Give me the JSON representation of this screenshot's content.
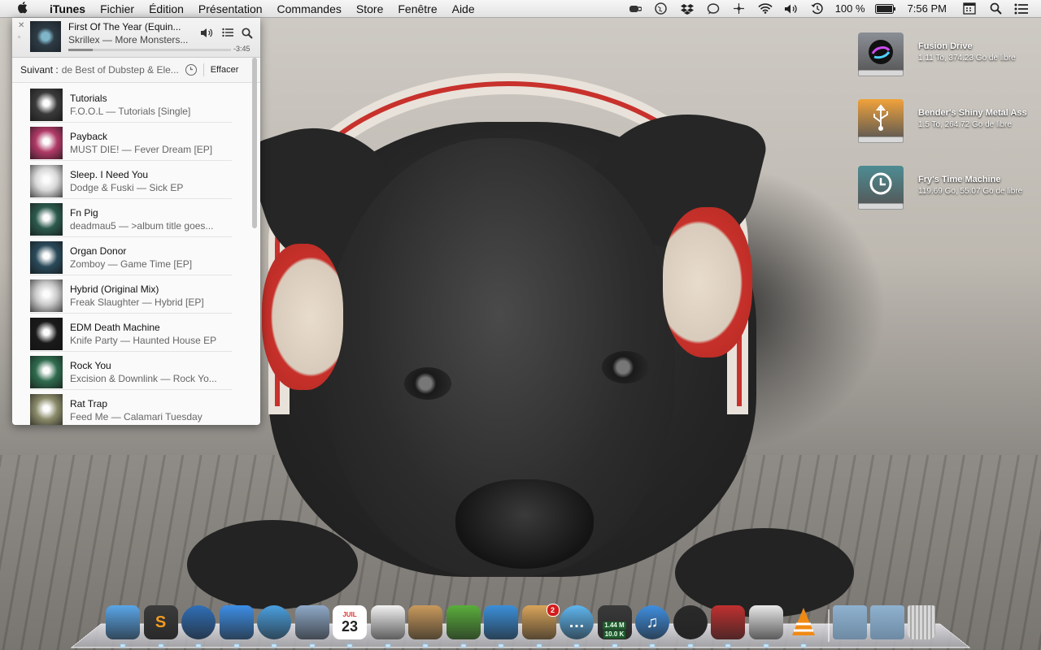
{
  "menubar": {
    "apple": "",
    "menus": [
      "iTunes",
      "Fichier",
      "Édition",
      "Présentation",
      "Commandes",
      "Store",
      "Fenêtre",
      "Aide"
    ],
    "battery": "100 %",
    "clock": "7:56 PM"
  },
  "player": {
    "now_playing": {
      "title": "First Of The Year (Equin...",
      "artist_album": "Skrillex — More Monsters...",
      "remaining": "-3:45",
      "progress": 0.15
    },
    "up_next": {
      "label": "Suivant :",
      "source": "de Best of Dubstep & Ele...",
      "clear": "Effacer"
    },
    "tracks": [
      {
        "title": "Tutorials",
        "sub": "F.O.O.L — Tutorials [Single]",
        "art": "#3a3a3a"
      },
      {
        "title": "Payback",
        "sub": "MUST DIE! — Fever Dream [EP]",
        "art": "#b03a66"
      },
      {
        "title": "Sleep. I Need You",
        "sub": "Dodge & Fuski — Sick EP",
        "art": "#d8d8d8"
      },
      {
        "title": "Fn Pig",
        "sub": "deadmau5 — >album title goes...",
        "art": "#2c5a4c"
      },
      {
        "title": "Organ Donor",
        "sub": "Zomboy — Game Time [EP]",
        "art": "#2a4a5a"
      },
      {
        "title": "Hybrid (Original Mix)",
        "sub": "Freak Slaughter — Hybrid [EP]",
        "art": "#c9c9c9"
      },
      {
        "title": "EDM Death Machine",
        "sub": "Knife Party — Haunted House EP",
        "art": "#1a1a1a"
      },
      {
        "title": "Rock You",
        "sub": "Excision & Downlink — Rock Yo...",
        "art": "#2f6b4e"
      },
      {
        "title": "Rat Trap",
        "sub": "Feed Me — Calamari Tuesday",
        "art": "#8a8a6a"
      }
    ]
  },
  "desktop": [
    {
      "name": "Fusion Drive",
      "info": "1.11 To, 374.23 Go de libre",
      "icon": "hard-drive-icon",
      "color": "#8b8f96"
    },
    {
      "name": "Bender's Shiny Metal Ass",
      "info": "1.5 To, 264.72 Go de libre",
      "icon": "usb-drive-icon",
      "color": "#f0a23a"
    },
    {
      "name": "Fry's Time Machine",
      "info": "119.69 Go, 55.07 Go de libre",
      "icon": "time-machine-drive-icon",
      "color": "#4d8c93"
    }
  ],
  "dock": {
    "calendar_day": "23",
    "calendar_month": "JUIL",
    "netstat_up": "1.44 M",
    "netstat_down": "10.0 K",
    "app_store_badge": "2",
    "apps": [
      {
        "name": "Finder",
        "icon": "finder-icon",
        "color": "#5aa6e8"
      },
      {
        "name": "Sublime Text",
        "icon": "sublime-icon",
        "color": "#3b3b3b"
      },
      {
        "name": "1Password",
        "icon": "onepassword-icon",
        "color": "#2f6fb8"
      },
      {
        "name": "App Store",
        "icon": "app-store-icon",
        "color": "#3d8ee6"
      },
      {
        "name": "Safari",
        "icon": "safari-icon",
        "color": "#4aa0e0"
      },
      {
        "name": "Mail stamp",
        "icon": "stamp-icon",
        "color": "#8fa9c8"
      },
      {
        "name": "Calendar",
        "icon": "calendar-icon",
        "color": "#f5f5f5"
      },
      {
        "name": "Reminders",
        "icon": "reminders-icon",
        "color": "#f2f2f2"
      },
      {
        "name": "Contacts",
        "icon": "contacts-icon",
        "color": "#c99a5c"
      },
      {
        "name": "Evernote",
        "icon": "evernote-icon",
        "color": "#5aae3c"
      },
      {
        "name": "Tweetbot",
        "icon": "tweetbot-icon",
        "color": "#3b8fd9"
      },
      {
        "name": "Package",
        "icon": "package-icon",
        "color": "#d9a45a"
      },
      {
        "name": "Messages",
        "icon": "messages-icon",
        "color": "#5fb6f0"
      },
      {
        "name": "Network monitor",
        "icon": "network-monitor-icon",
        "color": "#3a3a3a"
      },
      {
        "name": "iTunes",
        "icon": "itunes-icon",
        "color": "#3f8fe0"
      },
      {
        "name": "Camera",
        "icon": "camera-icon",
        "color": "#2a2a2a"
      },
      {
        "name": "Arcade",
        "icon": "joystick-icon",
        "color": "#c03030"
      },
      {
        "name": "Preview",
        "icon": "preview-icon",
        "color": "#e8e8e8"
      },
      {
        "name": "VLC",
        "icon": "vlc-icon",
        "color": "#f08a14"
      }
    ],
    "folders": [
      {
        "name": "Applications folder",
        "icon": "applications-folder-icon",
        "color": "#8fb2d0"
      },
      {
        "name": "Downloads folder",
        "icon": "downloads-folder-icon",
        "color": "#8fb2d0"
      },
      {
        "name": "Trash",
        "icon": "trash-icon",
        "color": "#cfcfcf"
      }
    ]
  }
}
